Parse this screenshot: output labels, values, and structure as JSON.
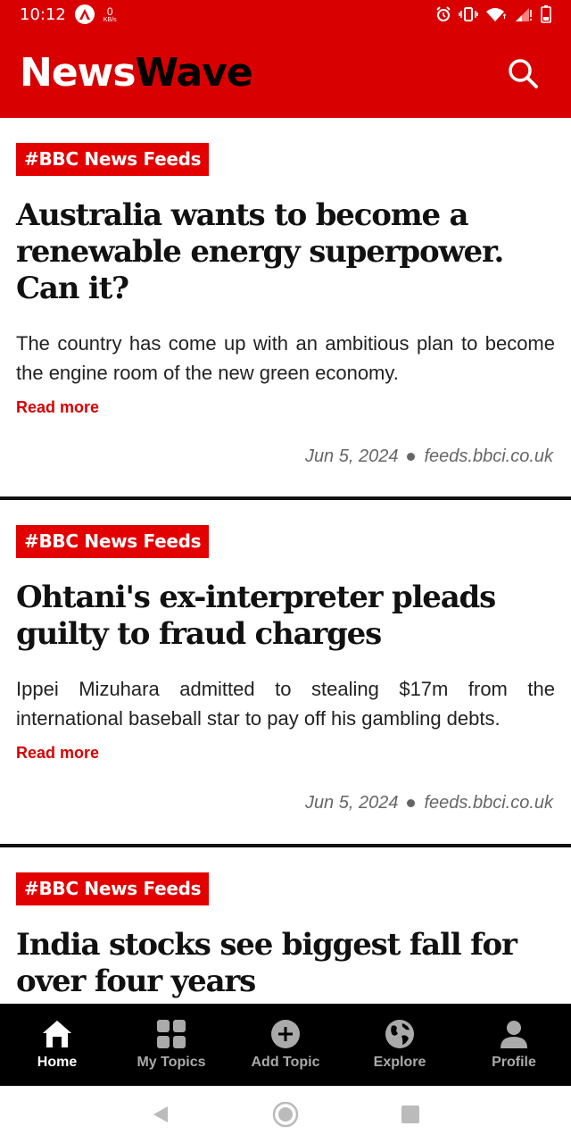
{
  "status_bar": {
    "time": "10:12",
    "kbs_value": "0",
    "kbs_unit": "KB/s",
    "icons": [
      "app-notification-icon",
      "alarm-icon",
      "vibrate-icon",
      "wifi-icon",
      "signal-icon",
      "battery-low-icon"
    ]
  },
  "header": {
    "brand_part1": "News",
    "brand_part2": "Wave",
    "search_icon": "search-icon"
  },
  "articles": [
    {
      "tag": "#BBC News Feeds",
      "headline": "Australia wants to become a renewable energy superpower. Can it?",
      "summary": "The country has come up with an ambitious plan to become the engine room of the new green economy.",
      "read_more": "Read more",
      "date": "Jun 5, 2024",
      "source": "feeds.bbci.co.uk"
    },
    {
      "tag": "#BBC News Feeds",
      "headline": "Ohtani's ex-interpreter pleads guilty to fraud charges",
      "summary": "Ippei Mizuhara admitted to stealing $17m from the international baseball star to pay off his gambling debts.",
      "read_more": "Read more",
      "date": "Jun 5, 2024",
      "source": "feeds.bbci.co.uk"
    },
    {
      "tag": "#BBC News Feeds",
      "headline": "India stocks see biggest fall for over four years"
    }
  ],
  "bottom_nav": {
    "items": [
      {
        "label": "Home",
        "icon": "home-icon",
        "active": true
      },
      {
        "label": "My Topics",
        "icon": "grid-icon",
        "active": false
      },
      {
        "label": "Add Topic",
        "icon": "add-circle-icon",
        "active": false
      },
      {
        "label": "Explore",
        "icon": "globe-icon",
        "active": false
      },
      {
        "label": "Profile",
        "icon": "person-icon",
        "active": false
      }
    ]
  },
  "system_nav": [
    "back-icon",
    "home-circle-icon",
    "recents-icon"
  ],
  "colors": {
    "brand_red": "#d80000",
    "tag_red": "#e20000",
    "nav_bg": "#000000",
    "meta_gray": "#666666"
  }
}
